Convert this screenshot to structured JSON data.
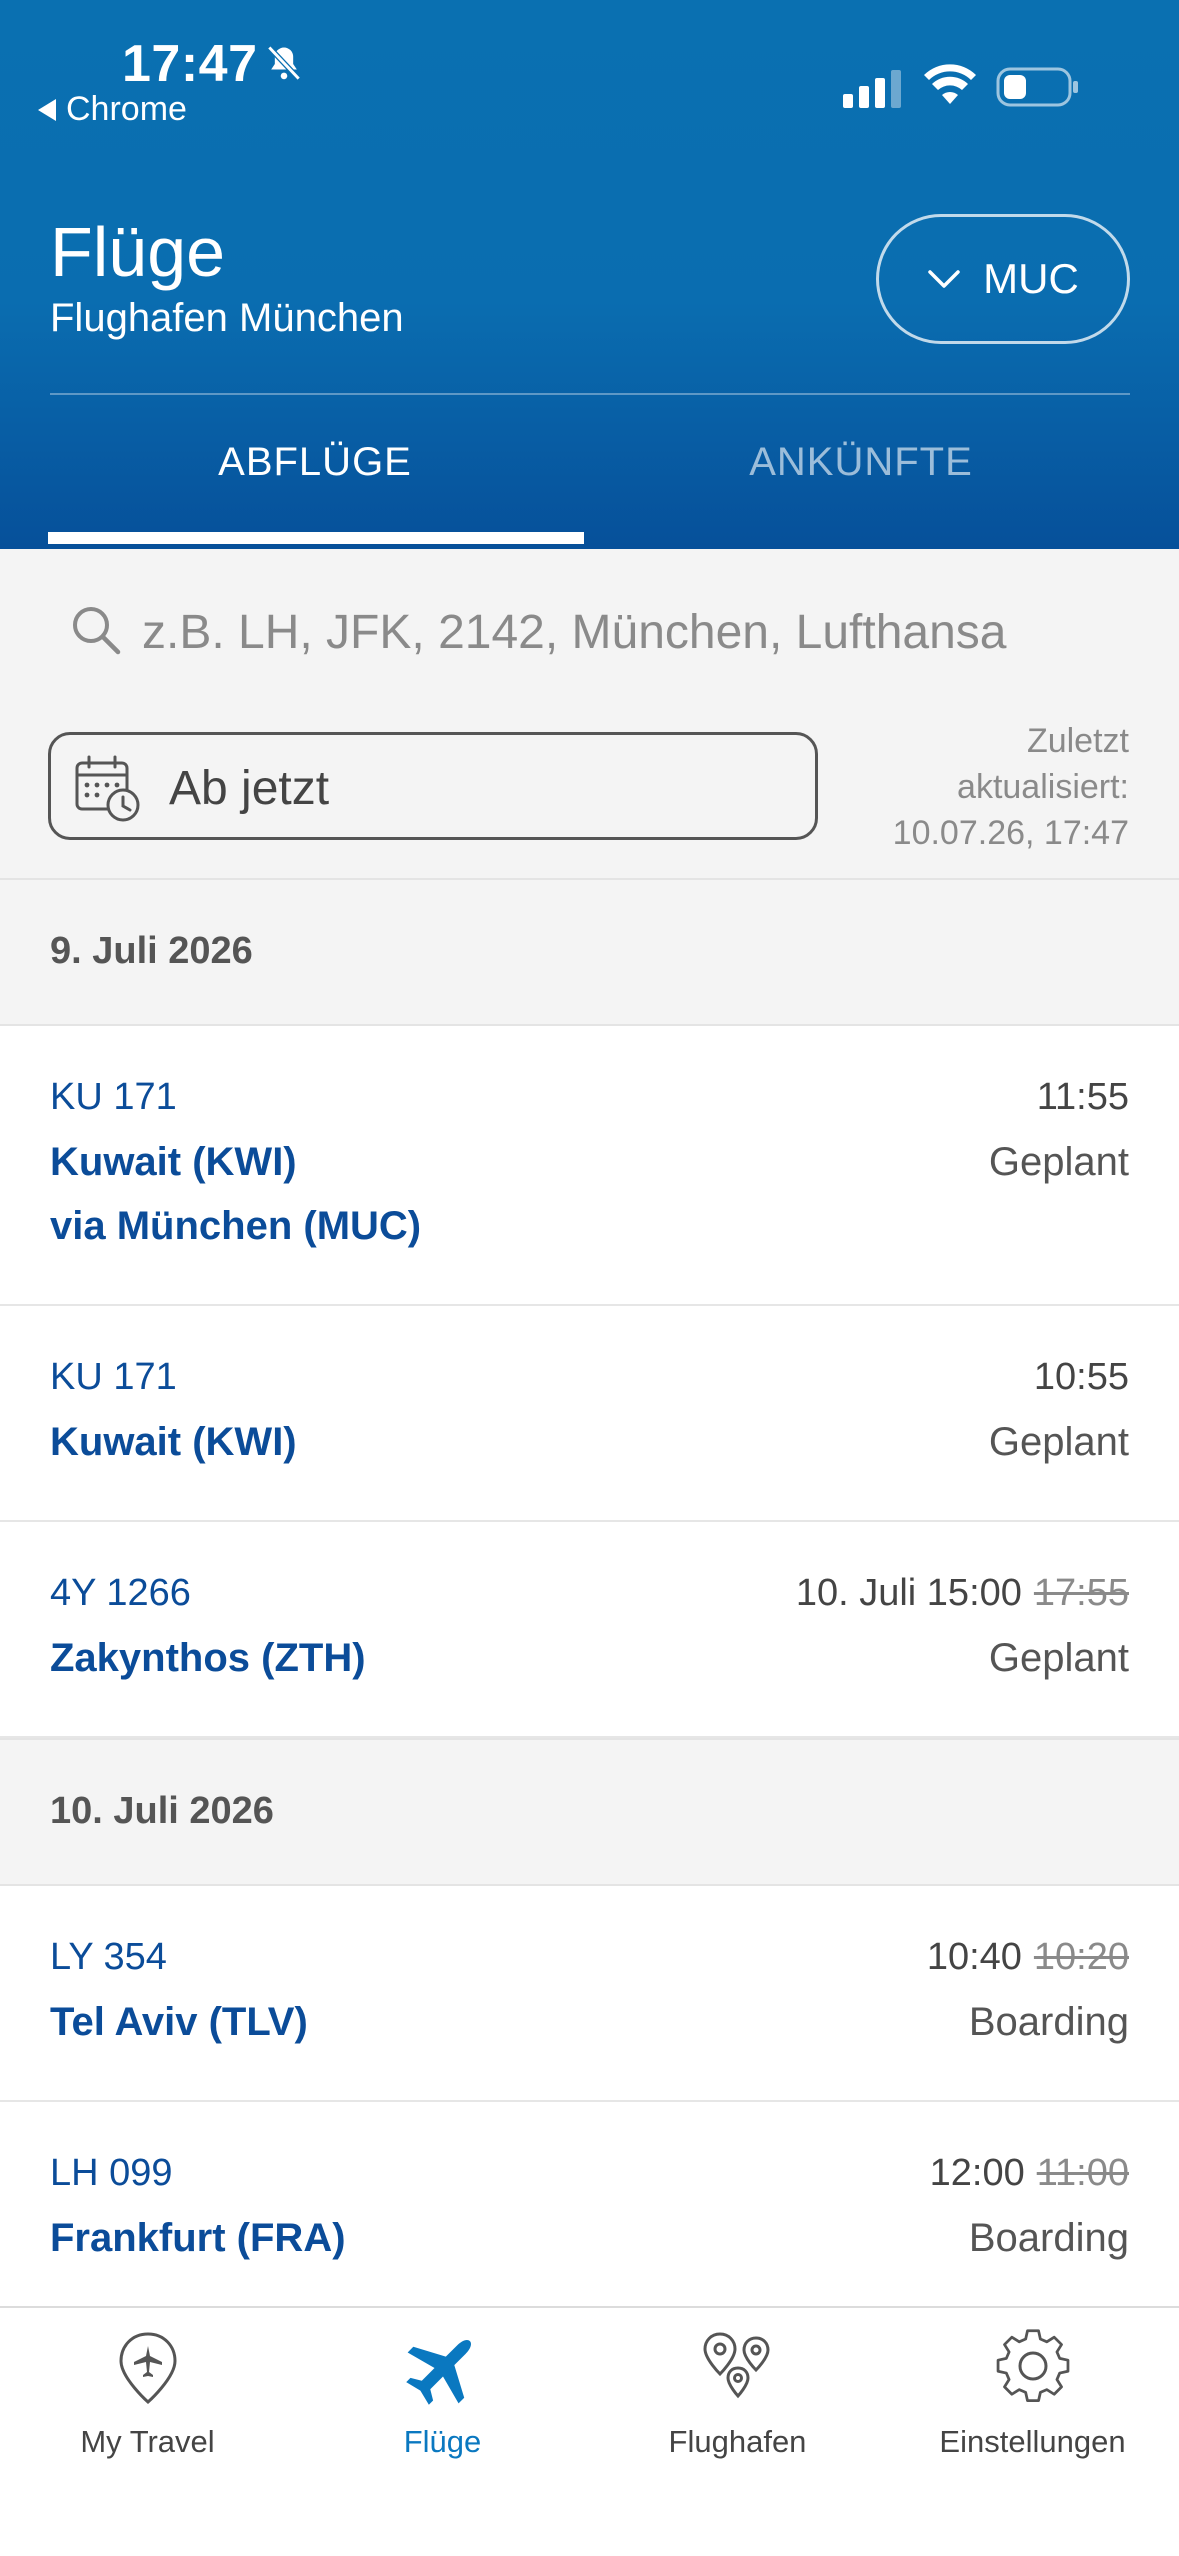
{
  "status_bar": {
    "time": "17:47",
    "back_label": "Chrome",
    "icons": [
      "bell-slash-icon",
      "cellular-signal-icon",
      "wifi-icon",
      "battery-icon"
    ]
  },
  "header": {
    "title": "Flüge",
    "subtitle": "Flughafen München",
    "airport_button": "MUC",
    "tabs": [
      {
        "label": "ABFLÜGE",
        "active": true
      },
      {
        "label": "ANKÜNFTE",
        "active": false
      }
    ]
  },
  "search": {
    "placeholder": "z.B. LH, JFK, 2142, München, Lufthansa",
    "date_label": "Ab jetzt",
    "updated_line1": "Zuletzt",
    "updated_line2": "aktualisiert:",
    "updated_line3": "10.07.26, 17:47"
  },
  "sections": [
    {
      "date": "9. Juli 2026",
      "flights": [
        {
          "number": "KU 171",
          "destination": "Kuwait (KWI)",
          "via": "via München (MUC)",
          "time": "11:55",
          "old_time": "",
          "status": "Geplant"
        },
        {
          "number": "KU 171",
          "destination": "Kuwait (KWI)",
          "via": "",
          "time": "10:55",
          "old_time": "",
          "status": "Geplant"
        },
        {
          "number": "4Y 1266",
          "destination": "Zakynthos (ZTH)",
          "via": "",
          "time": "10. Juli 15:00",
          "old_time": "17:55",
          "status": "Geplant"
        }
      ]
    },
    {
      "date": "10. Juli 2026",
      "flights": [
        {
          "number": "LY 354",
          "destination": "Tel Aviv (TLV)",
          "via": "",
          "time": "10:40",
          "old_time": "10:20",
          "status": "Boarding"
        },
        {
          "number": "LH 099",
          "destination": "Frankfurt (FRA)",
          "via": "",
          "time": "12:00",
          "old_time": "11:00",
          "status": "Boarding"
        }
      ]
    }
  ],
  "bottom_nav": [
    {
      "label": "My Travel",
      "icon": "location-plane-icon",
      "active": false
    },
    {
      "label": "Flüge",
      "icon": "airplane-icon",
      "active": true
    },
    {
      "label": "Flughafen",
      "icon": "map-pins-icon",
      "active": false
    },
    {
      "label": "Einstellungen",
      "icon": "gear-icon",
      "active": false
    }
  ],
  "colors": {
    "header_blue": "#0a70b1",
    "link_blue": "#0b4c99",
    "active_nav": "#0a78c0"
  }
}
